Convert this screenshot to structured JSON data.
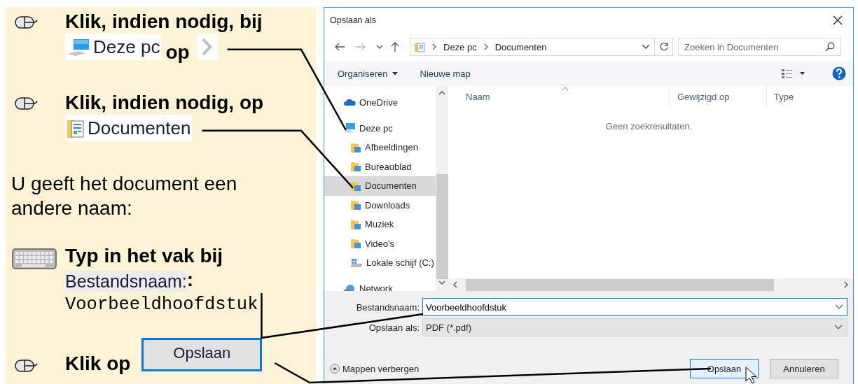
{
  "guide": {
    "steps": [
      {
        "kind": "mouse",
        "lines": [
          [
            {
              "kind": "bold",
              "text": "Klik, indien nodig, bij"
            }
          ],
          [
            {
              "kind": "pc-chip",
              "text": "Deze pc"
            },
            {
              "kind": "bold-low",
              "text": "op"
            },
            {
              "kind": "chevron"
            }
          ]
        ]
      },
      {
        "kind": "mouse",
        "lines": [
          [
            {
              "kind": "bold",
              "text": "Klik, indien nodig, op"
            }
          ],
          [
            {
              "kind": "documents-chip",
              "text": "Documenten"
            }
          ]
        ]
      },
      {
        "kind": "text",
        "lines": [
          [
            {
              "kind": "plain",
              "text": "U geeft het document een andere naam:"
            }
          ]
        ]
      },
      {
        "kind": "keyboard",
        "lines": [
          [
            {
              "kind": "bold",
              "text": "Typ in het vak bij"
            }
          ],
          [
            {
              "kind": "label",
              "text": "Bestandsnaam:"
            },
            {
              "kind": "bold",
              "text": ":"
            }
          ],
          [
            {
              "kind": "mono",
              "text": "Voorbeeldhoofdstuk"
            }
          ]
        ]
      },
      {
        "kind": "mouse",
        "lines": [
          [
            {
              "kind": "bold",
              "text": "Klik op"
            },
            {
              "kind": "button",
              "text": "Opslaan"
            }
          ]
        ]
      }
    ]
  },
  "dialog": {
    "title": "Opslaan als",
    "path": [
      "Deze pc",
      "Documenten"
    ],
    "search": {
      "placeholder": "Zoeken in Documenten"
    },
    "toolbar": [
      {
        "label": "Organiseren",
        "kind": "menu"
      },
      {
        "label": "Nieuwe map",
        "kind": "plain"
      }
    ],
    "nav": [
      {
        "label": "OneDrive",
        "kind": "cloud",
        "selected": false
      },
      {
        "label": "Deze pc",
        "kind": "computer",
        "selected": false,
        "children": [
          {
            "label": "Afbeeldingen",
            "kind": "folder",
            "selected": false
          },
          {
            "label": "Bureaublad",
            "kind": "folder",
            "selected": false
          },
          {
            "label": "Documenten",
            "kind": "folder",
            "selected": true
          },
          {
            "label": "Downloads",
            "kind": "folder",
            "selected": false
          },
          {
            "label": "Muziek",
            "kind": "folder",
            "selected": false
          },
          {
            "label": "Video's",
            "kind": "folder",
            "selected": false
          },
          {
            "label": "Lokale schijf (C:)",
            "kind": "drive",
            "selected": false
          }
        ]
      },
      {
        "label": "Network",
        "kind": "network",
        "selected": false
      }
    ],
    "columns": [
      "Naam",
      "Gewijzigd op",
      "Type"
    ],
    "empty_message": "Geen zoekresultaten.",
    "fields": [
      {
        "label": "Bestandsnaam:",
        "value": "Voorbeeldhoofdstuk",
        "kind": "input"
      },
      {
        "label": "Opslaan als:",
        "value": "PDF (*.pdf)",
        "kind": "select"
      }
    ],
    "toggle": "Mappen verbergen",
    "buttons": [
      {
        "label": "Opslaan",
        "default": true
      },
      {
        "label": "Annuleren",
        "default": false
      }
    ]
  }
}
